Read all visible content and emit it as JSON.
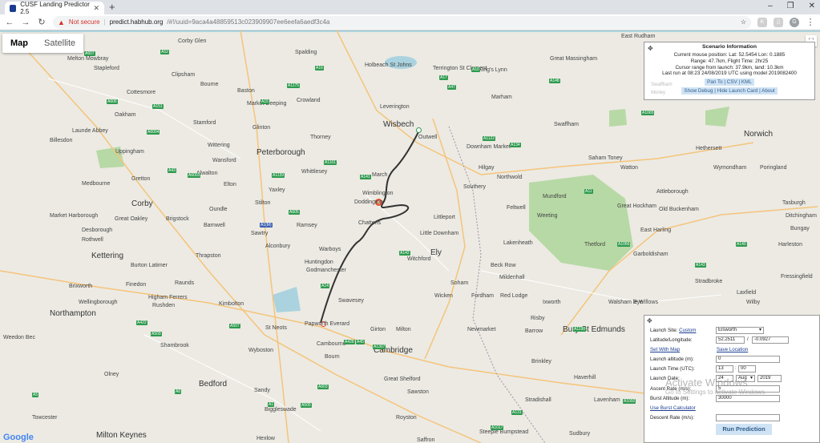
{
  "browser": {
    "tab_title": "CUSF Landing Predictor 2.5",
    "new_tab_icon": "+",
    "not_secure": "Not secure",
    "url_host": "predict.habhub.org",
    "url_path": "/#!/uuid=9aca4a48859513c023909907ee6eefa6aedf3c4a",
    "window_controls": [
      "–",
      "❐",
      "✕"
    ]
  },
  "map": {
    "map_type": [
      "Map",
      "Satellite"
    ],
    "google_logo": "Google",
    "zoom_in": "+",
    "zoom_out": "−",
    "places": [
      {
        "name": "Corby Glen"
      },
      {
        "name": "Spalding"
      },
      {
        "name": "Holbeach St Johns"
      },
      {
        "name": "Terrington St Clement"
      },
      {
        "name": "King's Lynn"
      },
      {
        "name": "Great Massingham"
      },
      {
        "name": "East Rudham"
      },
      {
        "name": "Melton Mowbray"
      },
      {
        "name": "Stapleford"
      },
      {
        "name": "Clipsham"
      },
      {
        "name": "Bourne"
      },
      {
        "name": "Baston"
      },
      {
        "name": "Cottesmore"
      },
      {
        "name": "Market Deeping"
      },
      {
        "name": "Crowland"
      },
      {
        "name": "Leverington"
      },
      {
        "name": "Wisbech"
      },
      {
        "name": "Marham"
      },
      {
        "name": "Swaffham"
      },
      {
        "name": "Oakham"
      },
      {
        "name": "Stamford"
      },
      {
        "name": "Glinton"
      },
      {
        "name": "Thorney"
      },
      {
        "name": "Outwell"
      },
      {
        "name": "Downham Market"
      },
      {
        "name": "Norwich"
      },
      {
        "name": "Launde Abbey"
      },
      {
        "name": "Uppingham"
      },
      {
        "name": "Wittering"
      },
      {
        "name": "Peterborough"
      },
      {
        "name": "Whittlesey"
      },
      {
        "name": "Hilgay"
      },
      {
        "name": "Saham Toney"
      },
      {
        "name": "Watton"
      },
      {
        "name": "Hethersett"
      },
      {
        "name": "Wymondham"
      },
      {
        "name": "Poringland"
      },
      {
        "name": "Billesdon"
      },
      {
        "name": "Wansford"
      },
      {
        "name": "Alwalton"
      },
      {
        "name": "Elton"
      },
      {
        "name": "Yaxley"
      },
      {
        "name": "March"
      },
      {
        "name": "Northwold"
      },
      {
        "name": "Medbourne"
      },
      {
        "name": "Gretton"
      },
      {
        "name": "Wimblington"
      },
      {
        "name": "Doddington"
      },
      {
        "name": "Southery"
      },
      {
        "name": "Mundford"
      },
      {
        "name": "Attleborough"
      },
      {
        "name": "Corby"
      },
      {
        "name": "Oundle"
      },
      {
        "name": "Stilton"
      },
      {
        "name": "Chatteris"
      },
      {
        "name": "Littleport"
      },
      {
        "name": "Feltwell"
      },
      {
        "name": "Weeting"
      },
      {
        "name": "Great Hockham"
      },
      {
        "name": "Old Buckenham"
      },
      {
        "name": "Tasburgh"
      },
      {
        "name": "Market Harborough"
      },
      {
        "name": "Great Oakley"
      },
      {
        "name": "Brigstock"
      },
      {
        "name": "Sawtry"
      },
      {
        "name": "Ramsey"
      },
      {
        "name": "Desborough"
      },
      {
        "name": "Barnwell"
      },
      {
        "name": "Little Downham"
      },
      {
        "name": "Lakenheath"
      },
      {
        "name": "Thetford"
      },
      {
        "name": "East Harling"
      },
      {
        "name": "Ditchingham"
      },
      {
        "name": "Bungay"
      },
      {
        "name": "Rothwell"
      },
      {
        "name": "Warboys"
      },
      {
        "name": "Kettering"
      },
      {
        "name": "Alconbury"
      },
      {
        "name": "Witchford"
      },
      {
        "name": "Ely"
      },
      {
        "name": "Beck Row"
      },
      {
        "name": "Garboldisham"
      },
      {
        "name": "Harleston"
      },
      {
        "name": "Burton Latimer"
      },
      {
        "name": "Thrapston"
      },
      {
        "name": "Huntingdon"
      },
      {
        "name": "Godmanchester"
      },
      {
        "name": "Soham"
      },
      {
        "name": "Mildenhall"
      },
      {
        "name": "Fressingfield"
      },
      {
        "name": "Brixworth"
      },
      {
        "name": "Finedon"
      },
      {
        "name": "Raunds"
      },
      {
        "name": "Wellingborough"
      },
      {
        "name": "Higham Ferrers"
      },
      {
        "name": "Rushden"
      },
      {
        "name": "Kimbolton"
      },
      {
        "name": "Swavesey"
      },
      {
        "name": "Wicken"
      },
      {
        "name": "Fordham"
      },
      {
        "name": "Red Lodge"
      },
      {
        "name": "Ixworth"
      },
      {
        "name": "Walsham le Willows"
      },
      {
        "name": "Eye"
      },
      {
        "name": "Stradbroke"
      },
      {
        "name": "Wilby"
      },
      {
        "name": "Laxfield"
      },
      {
        "name": "Risby"
      },
      {
        "name": "Northampton"
      },
      {
        "name": "St Neots"
      },
      {
        "name": "Papworth Everard"
      },
      {
        "name": "Girton"
      },
      {
        "name": "Milton"
      },
      {
        "name": "Newmarket"
      },
      {
        "name": "Barrow"
      },
      {
        "name": "Bury St Edmunds"
      },
      {
        "name": "Weedon Bec"
      },
      {
        "name": "Wyboston"
      },
      {
        "name": "Cambourne"
      },
      {
        "name": "Cambridge"
      },
      {
        "name": "Shambrook"
      },
      {
        "name": "Bourn"
      },
      {
        "name": "Olney"
      },
      {
        "name": "Bedford"
      },
      {
        "name": "Great Shelford"
      },
      {
        "name": "Sawston"
      },
      {
        "name": "Haverhill"
      },
      {
        "name": "Sandy"
      },
      {
        "name": "Biggleswade"
      },
      {
        "name": "Lavenham"
      },
      {
        "name": "Towcester"
      },
      {
        "name": "Milton Keynes"
      },
      {
        "name": "Hexlow"
      },
      {
        "name": "Saffron"
      },
      {
        "name": "Steeple Bumpstead"
      },
      {
        "name": "Sudbury"
      },
      {
        "name": "Brinkley"
      },
      {
        "name": "Stradishall"
      },
      {
        "name": "Royston"
      }
    ],
    "road_labels": [
      {
        "label": "A607",
        "color": "#2e9a4e"
      },
      {
        "label": "A52",
        "color": "#2e9a4e"
      },
      {
        "label": "A16",
        "color": "#2e9a4e"
      },
      {
        "label": "A17",
        "color": "#2e9a4e"
      },
      {
        "label": "A47",
        "color": "#2e9a4e"
      },
      {
        "label": "A10",
        "color": "#2e9a4e"
      },
      {
        "label": "A148",
        "color": "#2e9a4e"
      },
      {
        "label": "A1065",
        "color": "#2e9a4e"
      },
      {
        "label": "A606",
        "color": "#2e9a4e"
      },
      {
        "label": "A151",
        "color": "#2e9a4e"
      },
      {
        "label": "A1175",
        "color": "#2e9a4e"
      },
      {
        "label": "A15",
        "color": "#2e9a4e"
      },
      {
        "label": "A6004",
        "color": "#2e9a4e"
      },
      {
        "label": "A1101",
        "color": "#2e9a4e"
      },
      {
        "label": "A134",
        "color": "#2e9a4e"
      },
      {
        "label": "A1122",
        "color": "#2e9a4e"
      },
      {
        "label": "A11",
        "color": "#2e9a4e"
      },
      {
        "label": "A141",
        "color": "#2e9a4e"
      },
      {
        "label": "A1139",
        "color": "#2e9a4e"
      },
      {
        "label": "A605",
        "color": "#2e9a4e"
      },
      {
        "label": "A43",
        "color": "#2e9a4e"
      },
      {
        "label": "A6003",
        "color": "#2e9a4e"
      },
      {
        "label": "A1(M)",
        "color": "#3b5fb1"
      },
      {
        "label": "A142",
        "color": "#2e9a4e"
      },
      {
        "label": "A1066",
        "color": "#2e9a4e"
      },
      {
        "label": "A14",
        "color": "#2e9a4e"
      },
      {
        "label": "A140",
        "color": "#2e9a4e"
      },
      {
        "label": "A143",
        "color": "#2e9a4e"
      },
      {
        "label": "A509",
        "color": "#2e9a4e"
      },
      {
        "label": "A45",
        "color": "#2e9a4e"
      },
      {
        "label": "A428",
        "color": "#2e9a4e"
      },
      {
        "label": "A1307",
        "color": "#2e9a4e"
      },
      {
        "label": "A1198",
        "color": "#2e9a4e"
      },
      {
        "label": "A603",
        "color": "#2e9a4e"
      },
      {
        "label": "A505",
        "color": "#2e9a4e"
      },
      {
        "label": "A1017",
        "color": "#2e9a4e"
      },
      {
        "label": "A131",
        "color": "#2e9a4e"
      },
      {
        "label": "A1092",
        "color": "#2e9a4e"
      },
      {
        "label": "A5",
        "color": "#2e9a4e"
      },
      {
        "label": "A6",
        "color": "#2e9a4e"
      },
      {
        "label": "A1",
        "color": "#2e9a4e"
      },
      {
        "label": "A422",
        "color": "#2e9a4e"
      },
      {
        "label": "A507",
        "color": "#2e9a4e"
      }
    ]
  },
  "scenario": {
    "title": "Scenario Information",
    "mouse_position": "Current mouse position: Lat: 52.5454 Lon: 0.1885",
    "range_time": "Range: 47.7km, Flight Time: 2hr25",
    "cursor_range": "Cursor range from launch: 37.9km, land: 10.3km",
    "last_run": "Last run at 08:23 24/08/2019 UTC using model 2019082400",
    "links1": "Pan To | CSV | KML",
    "links2": "Show Debug | Hide Launch Card | About",
    "bg_text_1": "Swaffham",
    "bg_text_2": "Morley"
  },
  "launch": {
    "launch_site_label": "Launch Site:",
    "launch_site_link": "Custom",
    "launch_site_value": "Elsworth",
    "latlon_label": "Latitude/Longitude:",
    "lat": "52.2511",
    "lon": "-0.0927",
    "slash": "/",
    "set_with_map": "Set With Map",
    "save_location": "Save Location",
    "altitude_label": "Launch altitude (m):",
    "altitude": "0",
    "time_label": "Launch Time (UTC):",
    "hour": "13",
    "colon": ":",
    "minute": "00",
    "date_label": "Launch Date:",
    "day": "24",
    "month": "Aug",
    "year": "2019",
    "ascent_label": "Ascent Rate (m/s):",
    "ascent": "5",
    "burst_label": "Burst Altitude (m):",
    "burst": "30000",
    "burst_calc": "Use Burst Calculator",
    "descent_label": "Descent Rate (m/s):",
    "descent": "",
    "run_button": "Run Prediction"
  },
  "overlay": {
    "activate_title": "Activate Windows",
    "activate_sub": "Go to Settings to activate Windows."
  },
  "colors": {
    "path": "#333333",
    "road_green": "#2e9a4e",
    "road_blue": "#3b5fb1",
    "land": "#eceae3",
    "forest": "#b7d9a5",
    "water": "#aad3df"
  }
}
